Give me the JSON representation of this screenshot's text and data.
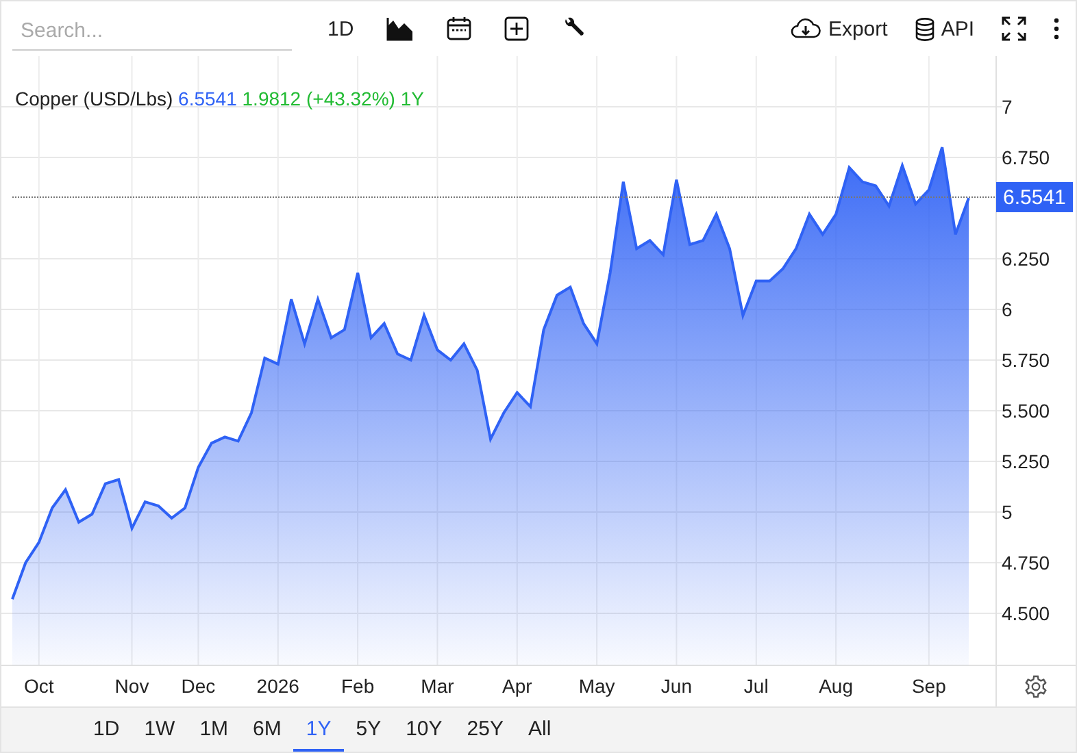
{
  "toolbar": {
    "search": {
      "placeholder": "Search..."
    },
    "interval_button": "1D",
    "export_button": "Export",
    "api_button": "API"
  },
  "legend": {
    "name": "Copper (USD/Lbs)",
    "price": "6.5541",
    "change": "1.9812 (+43.32%)",
    "period": "1Y"
  },
  "chart_data": {
    "type": "area",
    "grid": true,
    "ylim": [
      4.243,
      7.25
    ],
    "ref_lines": [
      {
        "axis": "y",
        "value": 6.5541,
        "label": "6.5541"
      }
    ],
    "yticks": [
      {
        "value": 4.5,
        "label": "4.500"
      },
      {
        "value": 4.75,
        "label": "4.750"
      },
      5,
      {
        "value": 5.25,
        "label": "5.250"
      },
      {
        "value": 5.5,
        "label": "5.500"
      },
      {
        "value": 5.75,
        "label": "5.750"
      },
      6,
      {
        "value": 6.25,
        "label": "6.250"
      },
      {
        "value": 6.75,
        "label": "6.750"
      },
      7
    ],
    "categories": [
      null,
      null,
      "Oct",
      null,
      null,
      null,
      null,
      null,
      null,
      "Nov",
      null,
      null,
      null,
      null,
      "Dec",
      null,
      null,
      null,
      null,
      null,
      "2026",
      null,
      null,
      null,
      null,
      null,
      "Feb",
      null,
      null,
      null,
      null,
      null,
      "Mar",
      null,
      null,
      null,
      null,
      null,
      "Apr",
      null,
      null,
      null,
      null,
      null,
      "May",
      null,
      null,
      null,
      null,
      null,
      "Jun",
      null,
      null,
      null,
      null,
      null,
      "Jul",
      null,
      null,
      null,
      null,
      null,
      "Aug",
      null,
      null,
      null,
      null,
      null,
      null,
      "Sep",
      null,
      null,
      null
    ],
    "series": [
      {
        "color": "#2f62f5",
        "values": [
          4.57,
          4.75,
          4.85,
          5.02,
          5.11,
          4.95,
          4.99,
          5.14,
          5.16,
          4.92,
          5.05,
          5.03,
          4.97,
          5.02,
          5.22,
          5.34,
          5.37,
          5.35,
          5.49,
          5.76,
          5.73,
          6.05,
          5.83,
          6.05,
          5.86,
          5.9,
          6.18,
          5.86,
          5.93,
          5.78,
          5.75,
          5.97,
          5.8,
          5.75,
          5.83,
          5.7,
          5.36,
          5.49,
          5.59,
          5.52,
          5.9,
          6.07,
          6.11,
          5.93,
          5.83,
          6.18,
          6.63,
          6.3,
          6.34,
          6.27,
          6.64,
          6.32,
          6.34,
          6.47,
          6.3,
          5.97,
          6.14,
          6.14,
          6.2,
          6.3,
          6.47,
          6.37,
          6.47,
          6.7,
          6.63,
          6.61,
          6.51,
          6.71,
          6.52,
          6.59,
          6.8,
          6.37,
          6.55
        ]
      }
    ]
  },
  "ranges": [
    {
      "label": "1D",
      "selected": false
    },
    {
      "label": "1W",
      "selected": false
    },
    {
      "label": "1M",
      "selected": false
    },
    {
      "label": "6M",
      "selected": false
    },
    {
      "label": "1Y",
      "selected": true
    },
    {
      "label": "5Y",
      "selected": false
    },
    {
      "label": "10Y",
      "selected": false
    },
    {
      "label": "25Y",
      "selected": false
    },
    {
      "label": "All",
      "selected": false
    }
  ]
}
